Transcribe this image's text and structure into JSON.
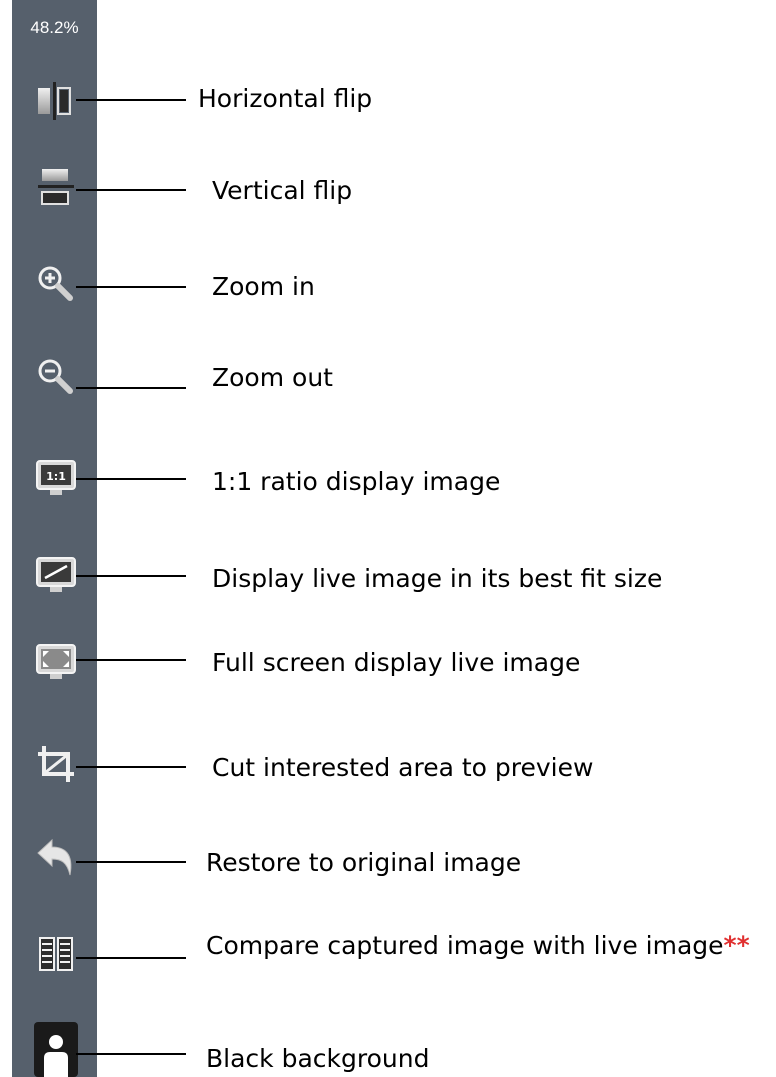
{
  "toolbar": {
    "zoom_level": "48.2%",
    "tools": [
      {
        "id": "horizontal-flip",
        "icon": "horizontal-flip-icon",
        "caption": "Horizontal flip"
      },
      {
        "id": "vertical-flip",
        "icon": "vertical-flip-icon",
        "caption": "Vertical flip"
      },
      {
        "id": "zoom-in",
        "icon": "zoom-in-icon",
        "caption": "Zoom in"
      },
      {
        "id": "zoom-out",
        "icon": "zoom-out-icon",
        "caption": "Zoom out"
      },
      {
        "id": "ratio-1-1",
        "icon": "ratio-1-1-icon",
        "icon_text": "1:1",
        "caption": "1:1 ratio display image"
      },
      {
        "id": "best-fit",
        "icon": "best-fit-icon",
        "caption": "Display live image in its best fit size"
      },
      {
        "id": "full-screen",
        "icon": "full-screen-icon",
        "caption": "Full screen display live image"
      },
      {
        "id": "crop",
        "icon": "crop-icon",
        "caption": "Cut interested area to preview"
      },
      {
        "id": "restore",
        "icon": "undo-arrow-icon",
        "caption": "Restore to original image"
      },
      {
        "id": "compare",
        "icon": "compare-icon",
        "caption": "Compare captured image with live image",
        "note": "**"
      },
      {
        "id": "black-background",
        "icon": "black-background-icon",
        "caption": "Black background"
      }
    ]
  },
  "colors": {
    "toolbar_bg": "#56606c",
    "note": "#e03030"
  }
}
